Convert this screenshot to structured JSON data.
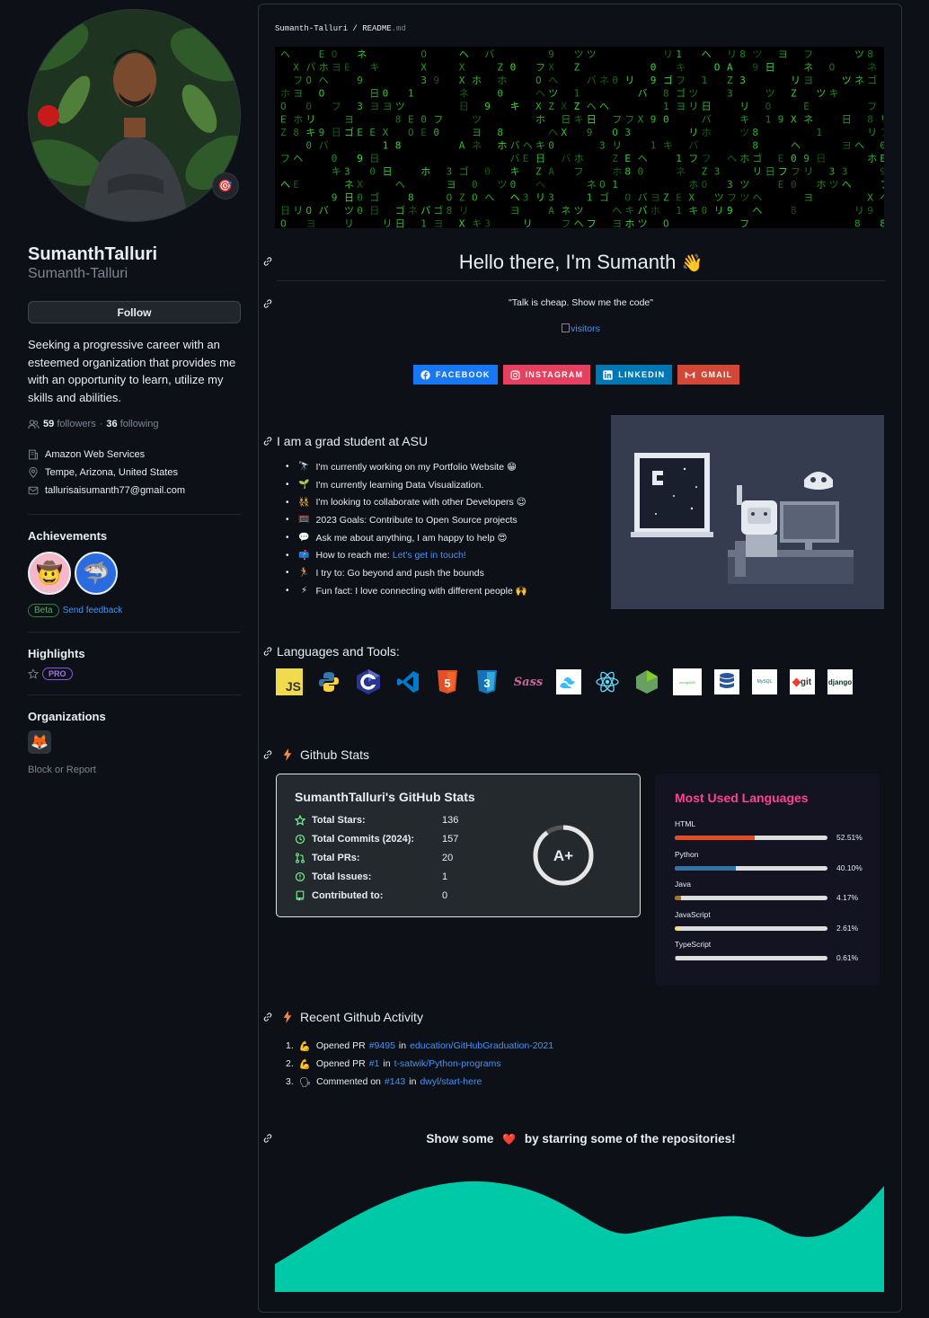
{
  "profile": {
    "name": "SumanthTalluri",
    "login": "Sumanth-Talluri",
    "follow_label": "Follow",
    "bio": "Seeking a progressive career with an esteemed organization that provides me with an opportunity to learn, utilize my skills and abilities.",
    "followers_count": "59",
    "followers_label": "followers",
    "following_count": "36",
    "following_label": "following",
    "separator": "·",
    "company": "Amazon Web Services",
    "location": "Tempe, Arizona, United States",
    "email": "tallurisaisumanth77@gmail.com",
    "status_emoji": "🎯"
  },
  "achievements": {
    "title": "Achievements",
    "badges": [
      "🤠",
      "🦈"
    ],
    "beta_label": "Beta",
    "feedback_label": "Send feedback"
  },
  "highlights": {
    "title": "Highlights",
    "pro_label": "PRO"
  },
  "organizations": {
    "title": "Organizations",
    "org_logo": "🦊",
    "block_label": "Block or Report"
  },
  "readme": {
    "breadcrumb_user": "Sumanth-Talluri",
    "breadcrumb_sep": "/",
    "breadcrumb_file": "README",
    "breadcrumb_ext": ".md",
    "hello": "Hello there, I'm Sumanth",
    "hello_emoji": "👋",
    "quote": "\"Talk is cheap. Show me the code\"",
    "visitors_alt": "visitors",
    "socials": [
      {
        "label": "FACEBOOK",
        "color": "#1877f2"
      },
      {
        "label": "INSTAGRAM",
        "color": "#e4405f"
      },
      {
        "label": "LINKEDIN",
        "color": "#0077b5"
      },
      {
        "label": "GMAIL",
        "color": "#d14836"
      }
    ],
    "about_title": "I am a grad student at ASU",
    "about_items": [
      {
        "emoji": "🔭",
        "text": "I'm currently working on my Portfolio Website",
        "tail": "😁"
      },
      {
        "emoji": "🌱",
        "text": "I'm currently learning Data Visualization.",
        "tail": ""
      },
      {
        "emoji": "👯",
        "text": "I'm looking to collaborate with other Developers",
        "tail": "😉"
      },
      {
        "emoji": "🥅",
        "text": "2023 Goals: Contribute to Open Source projects",
        "tail": ""
      },
      {
        "emoji": "💬",
        "text": "Ask me about anything, I am happy to help",
        "tail": "😍"
      },
      {
        "emoji": "📫",
        "text": "How to reach me: ",
        "link": "Let's get in touch!",
        "tail": ""
      },
      {
        "emoji": "🏃",
        "text": "I try to: Go beyond and push the bounds",
        "tail": ""
      },
      {
        "emoji": "⚡",
        "text": "Fun fact: I love connecting with different people",
        "tail": "🙌"
      }
    ],
    "tools_title": "Languages and Tools:",
    "tools": [
      {
        "name": "js",
        "label": "JS",
        "color": "#f0db4f"
      },
      {
        "name": "python",
        "label": "",
        "color": "#3776ab"
      },
      {
        "name": "c",
        "label": "C",
        "color": "#283593"
      },
      {
        "name": "vscode",
        "label": "",
        "color": "#007acc"
      },
      {
        "name": "html5",
        "label": "5",
        "color": "#e34f26"
      },
      {
        "name": "css3",
        "label": "3",
        "color": "#1572b6"
      },
      {
        "name": "sass",
        "label": "Sass",
        "color": "#cc6699"
      },
      {
        "name": "tailwind",
        "label": "",
        "color": "#38bdf8"
      },
      {
        "name": "react",
        "label": "",
        "color": "#61dafb"
      },
      {
        "name": "nodejs",
        "label": "",
        "color": "#68a063"
      },
      {
        "name": "mongodb",
        "label": "mongoDB",
        "color": "#ffffff"
      },
      {
        "name": "database",
        "label": "",
        "color": "#ffffff"
      },
      {
        "name": "mysql",
        "label": "MySQL",
        "color": "#ffffff"
      },
      {
        "name": "git",
        "label": "git",
        "color": "#ffffff"
      },
      {
        "name": "django",
        "label": "django",
        "color": "#ffffff"
      }
    ],
    "stats_section_title": "Github Stats",
    "stats": {
      "title": "SumanthTalluri's GitHub Stats",
      "rows": [
        {
          "label": "Total Stars:",
          "value": "136"
        },
        {
          "label": "Total Commits (2024):",
          "value": "157"
        },
        {
          "label": "Total PRs:",
          "value": "20"
        },
        {
          "label": "Total Issues:",
          "value": "1"
        },
        {
          "label": "Contributed to:",
          "value": "0"
        }
      ],
      "grade": "A+",
      "grade_progress": 0.9
    },
    "languages": {
      "title": "Most Used Languages",
      "items": [
        {
          "name": "HTML",
          "pct": "52.51%",
          "value": 52.51,
          "color": "#e34c26"
        },
        {
          "name": "Python",
          "pct": "40.10%",
          "value": 40.1,
          "color": "#3572a5"
        },
        {
          "name": "Java",
          "pct": "4.17%",
          "value": 4.17,
          "color": "#b07219"
        },
        {
          "name": "JavaScript",
          "pct": "2.61%",
          "value": 2.61,
          "color": "#f1e05a"
        },
        {
          "name": "TypeScript",
          "pct": "0.61%",
          "value": 0.61,
          "color": "#3178c6"
        }
      ]
    },
    "activity_title": "Recent Github Activity",
    "activity": [
      {
        "num": "1.",
        "emoji": "💪",
        "verb": "Opened PR",
        "ref": "#9495",
        "in": "in",
        "repo": "education/GitHubGraduation-2021"
      },
      {
        "num": "2.",
        "emoji": "💪",
        "verb": "Opened PR",
        "ref": "#1",
        "in": "in",
        "repo": "t-satwik/Python-programs"
      },
      {
        "num": "3.",
        "emoji": "🗣",
        "verb": "Commented on",
        "ref": "#143",
        "in": "in",
        "repo": "dwyl/start-here"
      }
    ],
    "show_pre": "Show some",
    "show_heart": "❤️",
    "show_post": "by starring some of the repositories!",
    "wave_color": "#00c9a7",
    "matrix_color": "#35e035"
  }
}
